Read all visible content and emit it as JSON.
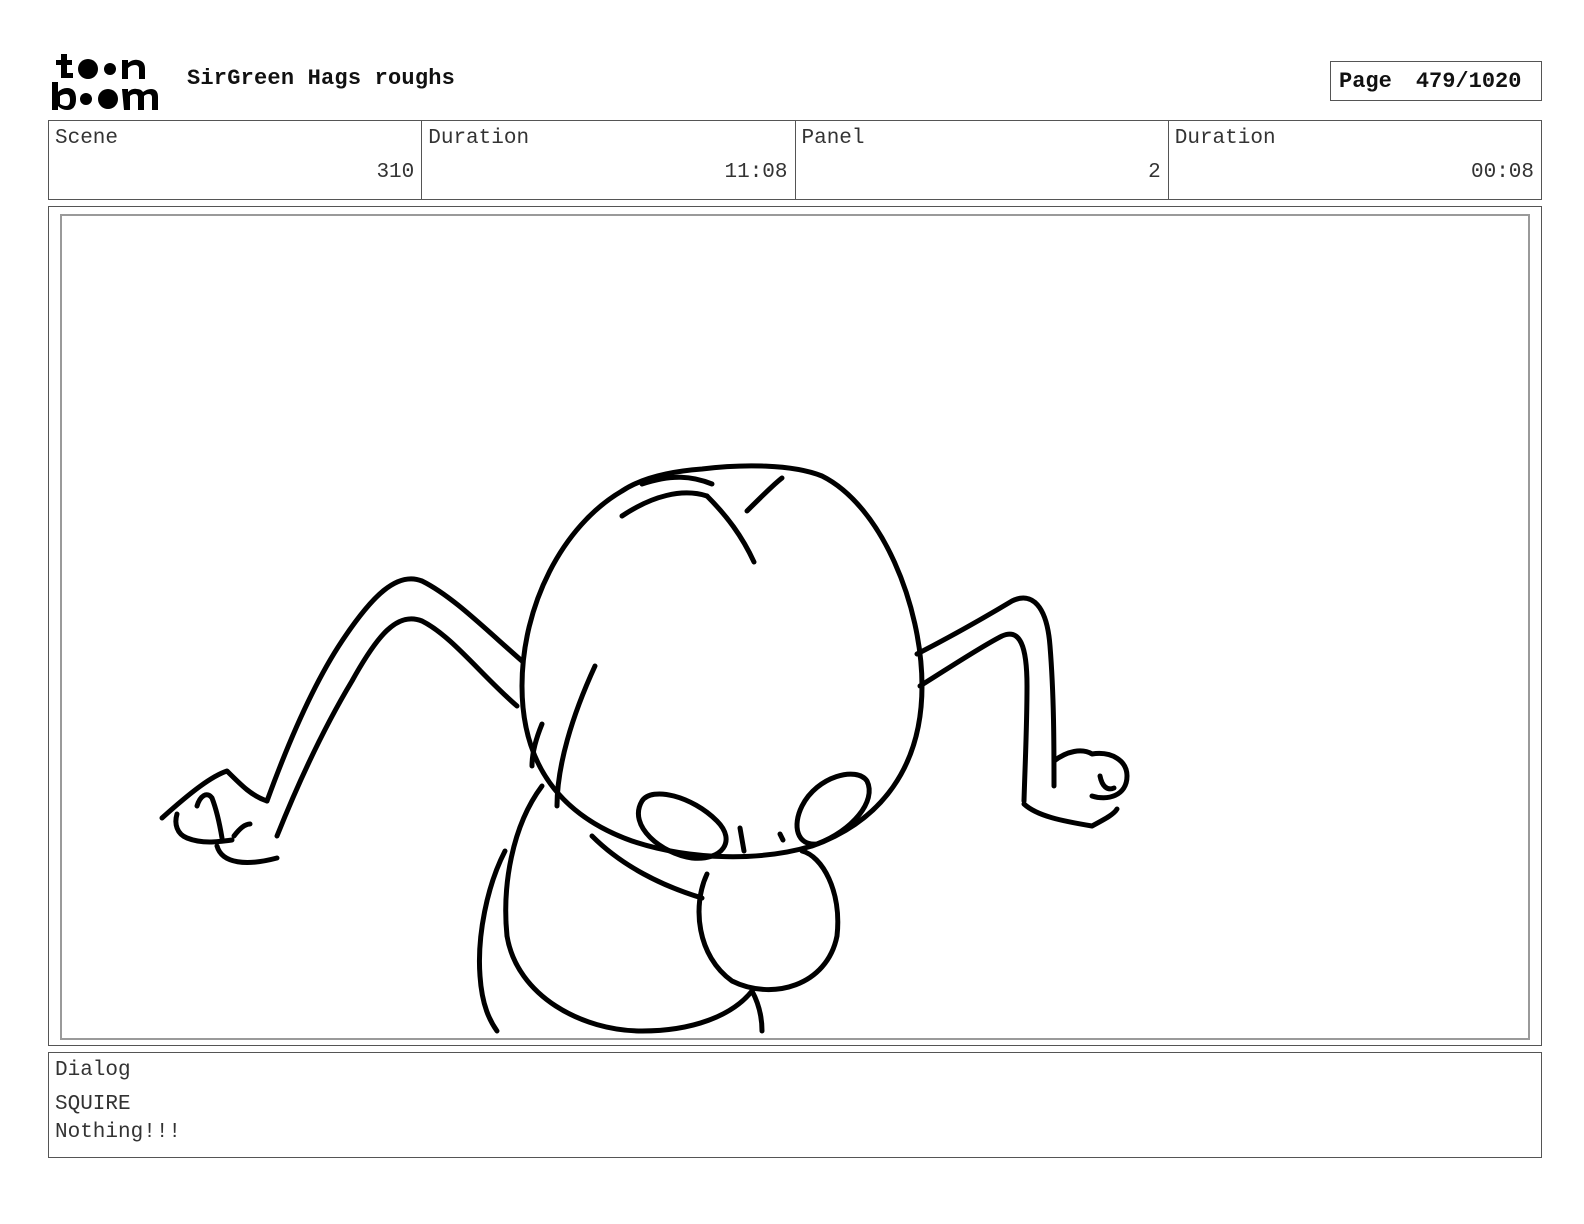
{
  "header": {
    "project_title": "SirGreen Hags roughs",
    "page_label": "Page",
    "page_value": "479/1020",
    "logo_name": "toon-boom-logo"
  },
  "info": {
    "scene_label": "Scene",
    "scene_value": "310",
    "scene_duration_label": "Duration",
    "scene_duration_value": "11:08",
    "panel_label": "Panel",
    "panel_value": "2",
    "panel_duration_label": "Duration",
    "panel_duration_value": "00:08"
  },
  "dialog": {
    "label": "Dialog",
    "speaker": "SQUIRE",
    "line": "Nothing!!!"
  },
  "colors": {
    "ink": "#000000",
    "border": "#555555",
    "frame": "#9a9a9a"
  }
}
